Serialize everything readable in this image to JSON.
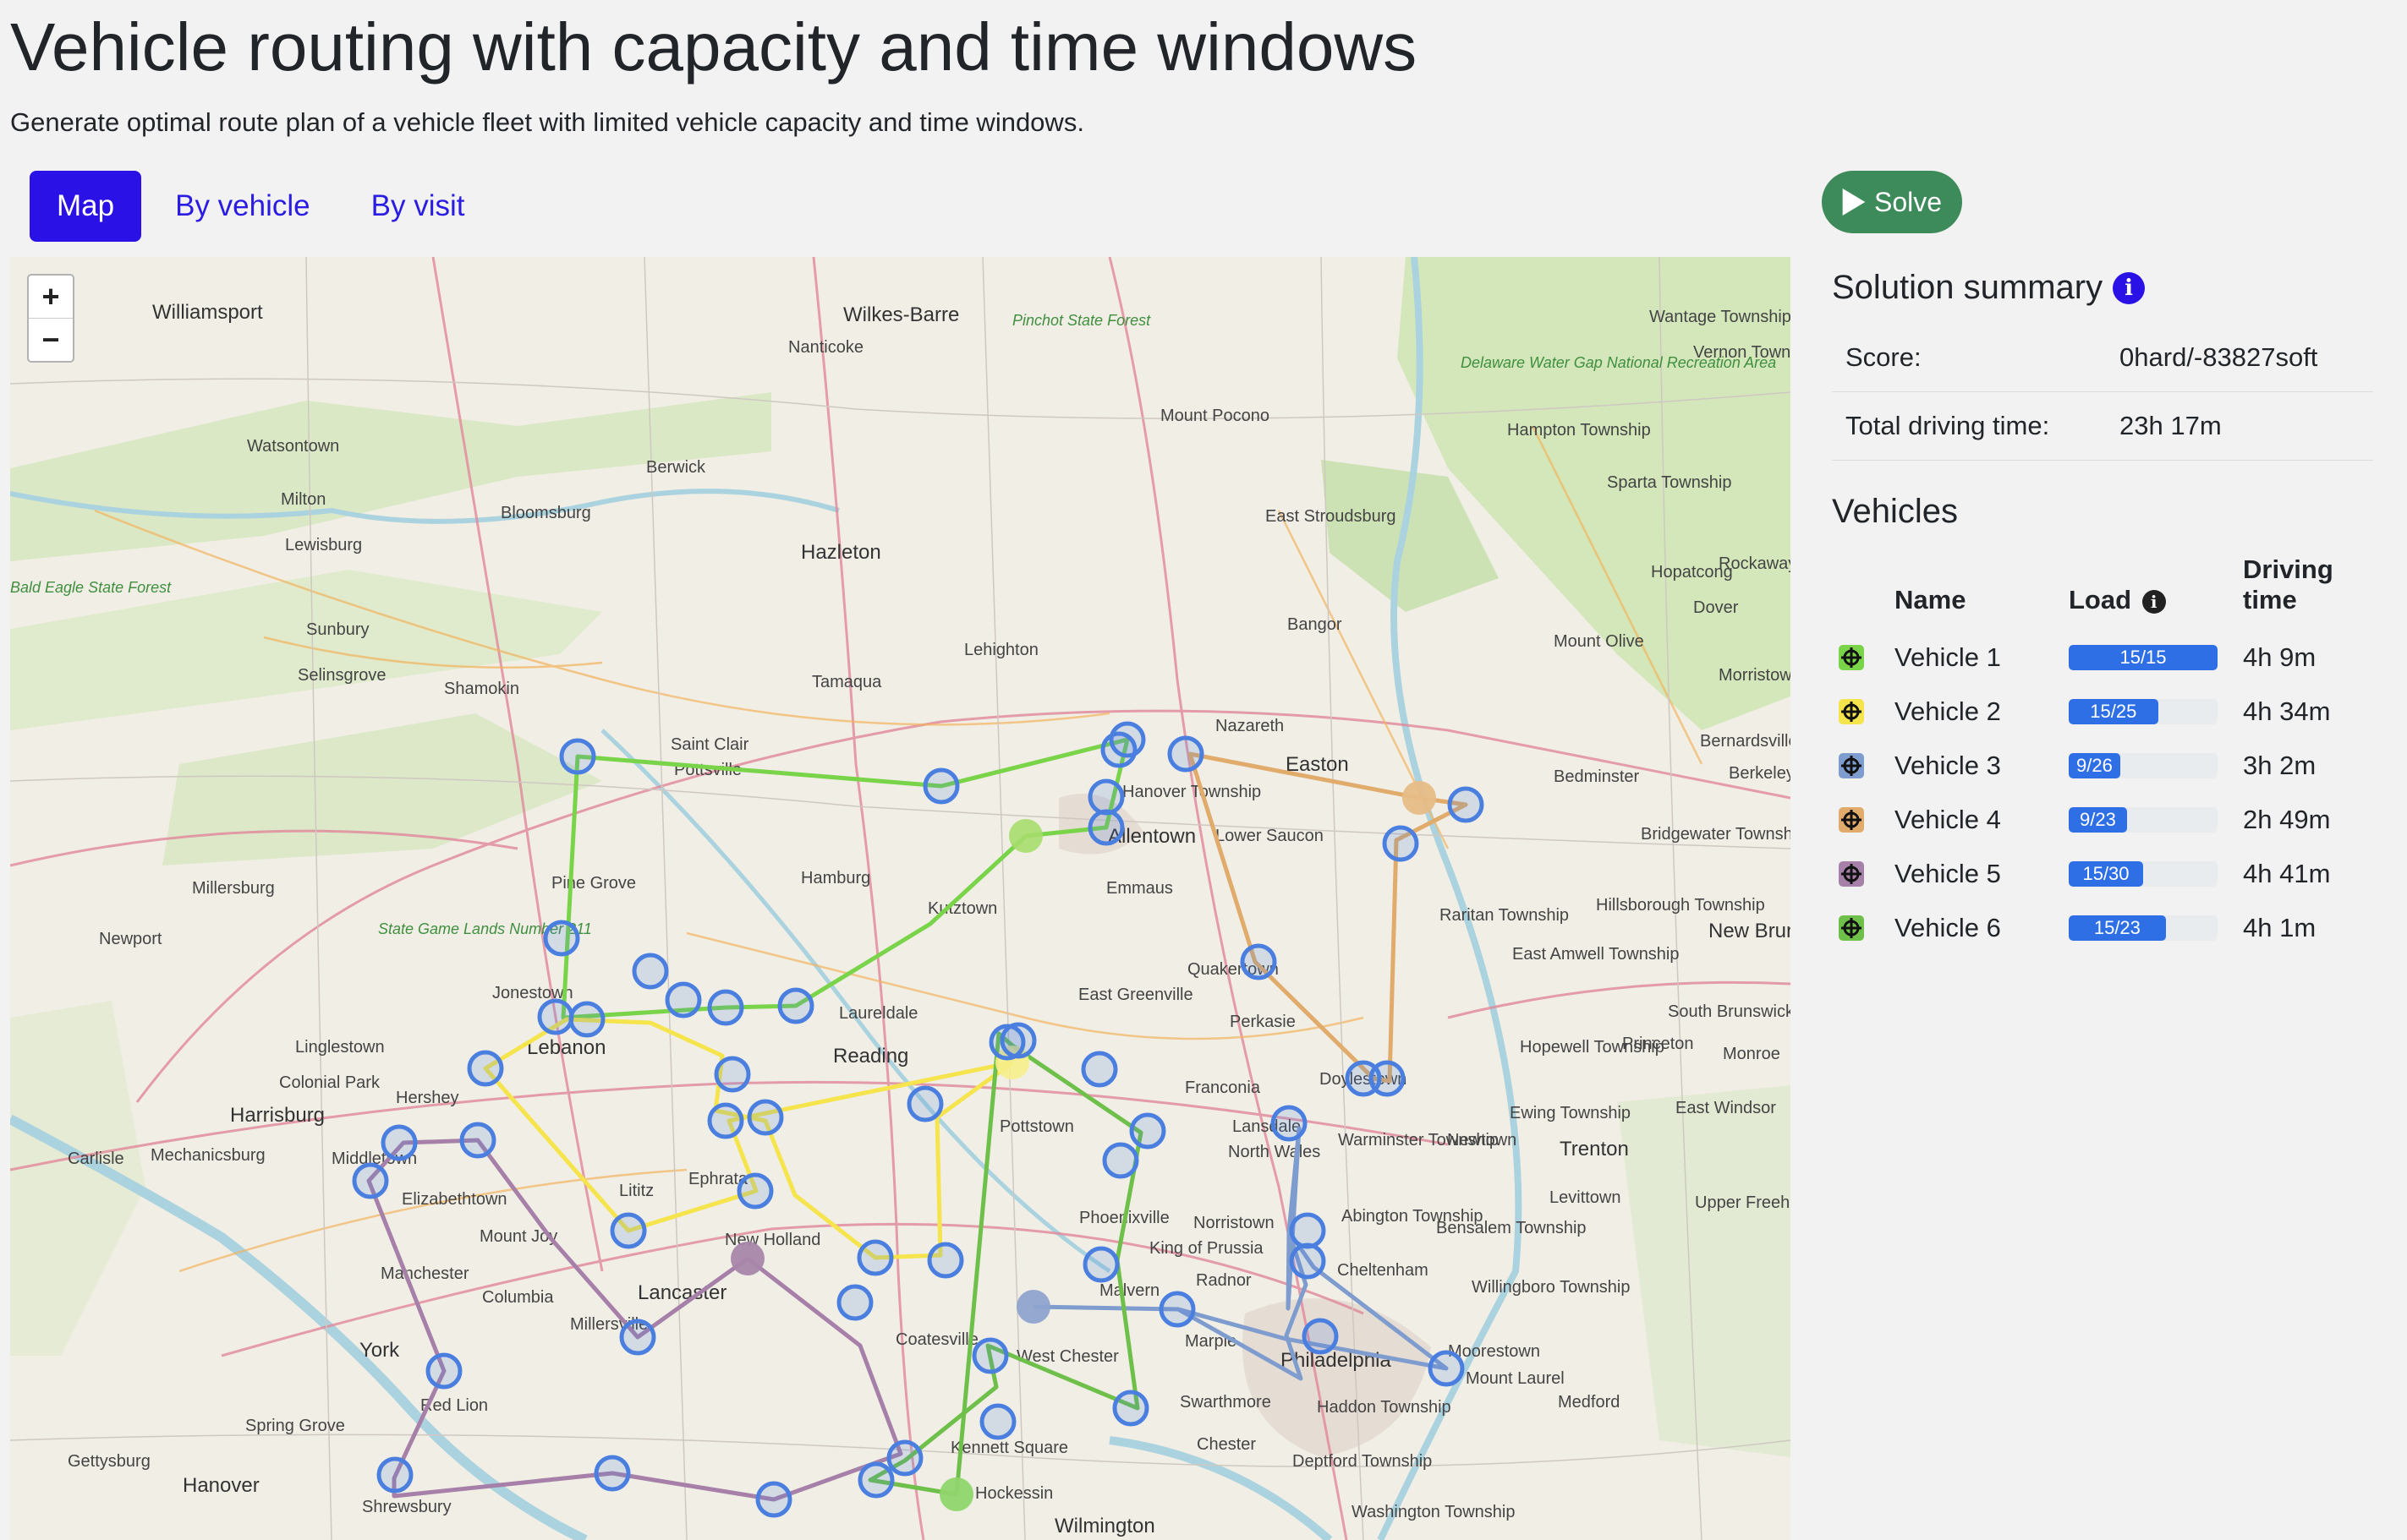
{
  "header": {
    "title": "Vehicle routing with capacity and time windows",
    "subtitle": "Generate optimal route plan of a vehicle fleet with limited vehicle capacity and time windows."
  },
  "tabs": [
    {
      "label": "Map",
      "active": true
    },
    {
      "label": "By vehicle",
      "active": false
    },
    {
      "label": "By visit",
      "active": false
    }
  ],
  "solve_button": {
    "label": "Solve",
    "icon": "play-icon"
  },
  "zoom": {
    "in": "+",
    "out": "−"
  },
  "summary": {
    "title": "Solution summary",
    "info_icon": "i",
    "rows": [
      {
        "label": "Score:",
        "value": "0hard/-83827soft"
      },
      {
        "label": "Total driving time:",
        "value": "23h 17m"
      }
    ]
  },
  "vehicles": {
    "title": "Vehicles",
    "columns": {
      "name": "Name",
      "load": "Load",
      "driving_time_1": "Driving",
      "driving_time_2": "time"
    },
    "rows": [
      {
        "name": "Vehicle 1",
        "load": "15/15",
        "fraction": 1.0,
        "driving": "4h 9m",
        "color": "#7ad44a"
      },
      {
        "name": "Vehicle 2",
        "load": "15/25",
        "fraction": 0.6,
        "driving": "4h 34m",
        "color": "#f5e44c"
      },
      {
        "name": "Vehicle 3",
        "load": "9/26",
        "fraction": 0.346,
        "driving": "3h 2m",
        "color": "#7f9ccf"
      },
      {
        "name": "Vehicle 4",
        "load": "9/23",
        "fraction": 0.391,
        "driving": "2h 49m",
        "color": "#e0ab6b"
      },
      {
        "name": "Vehicle 5",
        "load": "15/30",
        "fraction": 0.5,
        "driving": "4h 41m",
        "color": "#a680a8"
      },
      {
        "name": "Vehicle 6",
        "load": "15/23",
        "fraction": 0.652,
        "driving": "4h 1m",
        "color": "#6ec04a"
      }
    ]
  },
  "map_labels": {
    "places": [
      "Williamsport",
      "Wilkes-Barre",
      "Nanticoke",
      "Watsontown",
      "Milton",
      "Lewisburg",
      "Berwick",
      "Bloomsburg",
      "Hazleton",
      "Mount Pocono",
      "East Stroudsburg",
      "Sunbury",
      "Selinsgrove",
      "Shamokin",
      "Tamaqua",
      "Lehighton",
      "Bangor",
      "Nazareth",
      "Easton",
      "Saint Clair",
      "Pottsville",
      "Hanover Township",
      "Allentown",
      "Lower Saucon",
      "Emmaus",
      "Hamburg",
      "Kutztown",
      "Pine Grove",
      "Millersburg",
      "Newport",
      "Jonestown",
      "Lebanon",
      "Laureldale",
      "Reading",
      "East Greenville",
      "Quakertown",
      "Perkasie",
      "Linglestown",
      "Colonial Park",
      "Hershey",
      "Harrisburg",
      "Mechanicsburg",
      "Carlisle",
      "Middletown",
      "Elizabethtown",
      "Lititz",
      "Ephrata",
      "Pottstown",
      "Franconia",
      "Doylestown",
      "Lansdale",
      "North Wales",
      "Warminster Township",
      "Newtown",
      "Trenton",
      "Mount Joy",
      "New Holland",
      "Manchester",
      "Columbia",
      "Lancaster",
      "Millersville",
      "Phoenixville",
      "Norristown",
      "King of Prussia",
      "Radnor",
      "Malvern",
      "Abington Township",
      "Bensalem Township",
      "Cheltenham",
      "Willingboro Township",
      "Coatesville",
      "West Chester",
      "Marple",
      "Philadelphia",
      "Moorestown",
      "Mount Laurel",
      "Medford",
      "York",
      "Red Lion",
      "Spring Grove",
      "Gettysburg",
      "Hanover",
      "Shrewsbury",
      "Kennett Square",
      "Hockessin",
      "Swarthmore",
      "Haddon Township",
      "Chester",
      "Deptford Township",
      "Wilmington",
      "Washington Township",
      "Wantage Township",
      "Vernon Township",
      "Hampton Township",
      "Sparta Township",
      "Hopatcong",
      "Rockaway Township",
      "Dover",
      "Mount Olive",
      "Morristown",
      "Bernardsville",
      "Bedminster",
      "Bridgewater Township",
      "Raritan Township",
      "Hillsborough Township",
      "East Amwell Township",
      "Hopewell Township",
      "Princeton",
      "South Brunswick",
      "Monroe",
      "Ewing Township",
      "East Windsor",
      "Levittown",
      "Upper Freehold Township",
      "New Brunswick",
      "Berkeley"
    ],
    "parks": [
      "Bald Eagle State Forest",
      "Pinchot State Forest",
      "Delaware Water Gap National Recreation Area",
      "State Game Lands Number 211"
    ]
  },
  "legend_colors": {
    "visit_marker": "#4a7fe0",
    "map_background": "#f1eee6"
  }
}
